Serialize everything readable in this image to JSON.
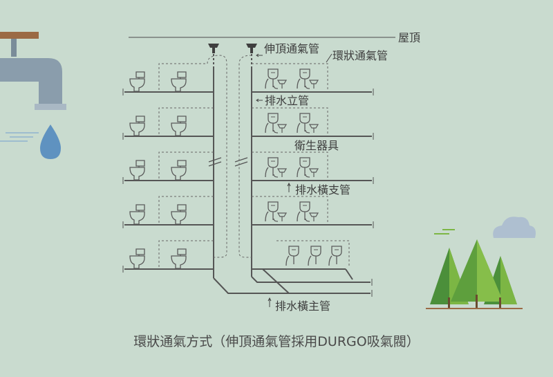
{
  "labels": {
    "roof": "屋頂",
    "top_vent": "伸頂通氣管",
    "loop_vent": "環狀通氣管",
    "drain_stack": "排水立管",
    "fixtures": "衛生器具",
    "branch_drain": "排水橫支管",
    "main_drain": "排水橫主管"
  },
  "caption": "環狀通氣方式（伸頂通氣管採用DURGO吸氣閥）",
  "diagram": {
    "left_floors": 5,
    "right_floors_full": 4,
    "right_floors_bottom_fixtures": 3,
    "toilets_per_left_floor": 2,
    "urinals_per_right_floor": 2
  },
  "colors": {
    "background": "#c9dbcf",
    "pipe": "#555555",
    "dashed": "#666666",
    "fixture": "#5a5a5a",
    "faucet": "#8a9dac",
    "faucet_wood": "#9b6a45",
    "water": "#5f92c0",
    "tree_dark": "#4b8f3a",
    "tree_light": "#7cb644",
    "cloud": "#aebfd0",
    "text": "#3d3d3d"
  },
  "icons": [
    "faucet-icon",
    "water-drop-icon",
    "trees-icon",
    "cloud-icon",
    "toilet-icon",
    "urinal-icon",
    "vent-valve-icon"
  ]
}
